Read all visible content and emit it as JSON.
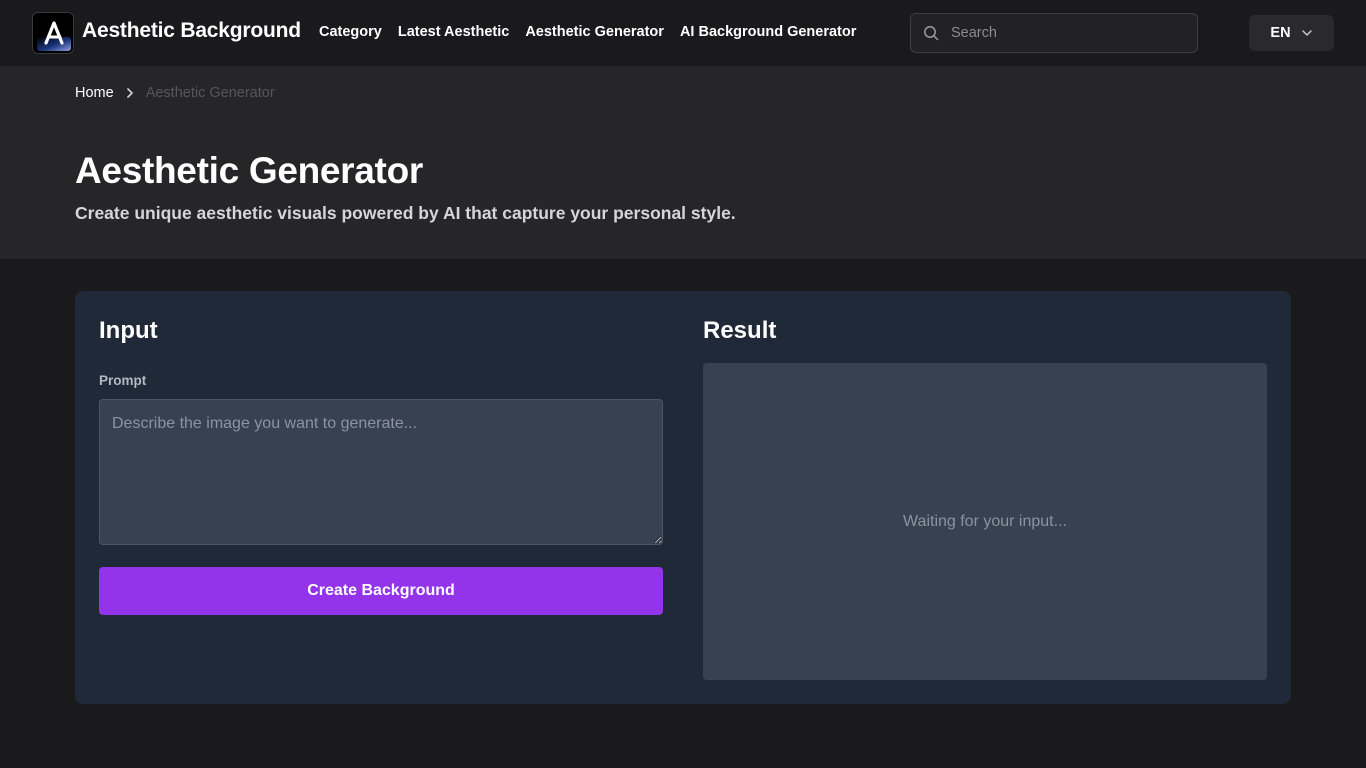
{
  "header": {
    "brand": "Aesthetic Background",
    "nav": [
      {
        "label": "Category"
      },
      {
        "label": "Latest Aesthetic"
      },
      {
        "label": "Aesthetic Generator"
      },
      {
        "label": "AI Background Generator"
      }
    ],
    "search": {
      "placeholder": "Search",
      "value": ""
    },
    "language": "EN",
    "icons": [
      "logo-icon",
      "search-icon",
      "chevron-down-icon"
    ]
  },
  "breadcrumb": {
    "home": "Home",
    "current": "Aesthetic Generator"
  },
  "hero": {
    "title": "Aesthetic Generator",
    "subtitle": "Create unique aesthetic visuals powered by AI that capture your personal style."
  },
  "input": {
    "title": "Input",
    "prompt_label": "Prompt",
    "prompt_placeholder": "Describe the image you want to generate...",
    "prompt_value": "",
    "button_label": "Create Background"
  },
  "result": {
    "title": "Result",
    "status": "Waiting for your input..."
  },
  "colors": {
    "accent": "#9333ea",
    "card_bg": "#1f2937",
    "field_bg": "#374151",
    "page_bg": "#1a1a1c",
    "hero_bg": "#262628"
  }
}
